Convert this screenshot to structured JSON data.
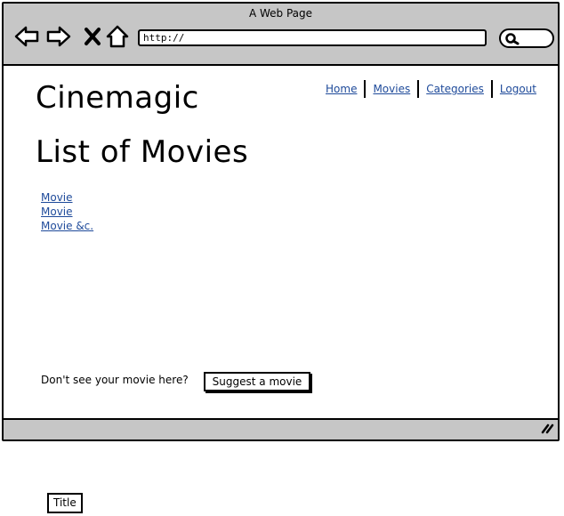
{
  "window": {
    "title": "A Web Page"
  },
  "browser": {
    "url": "http://"
  },
  "nav": {
    "links": [
      "Home",
      "Movies",
      "Categories",
      "Logout"
    ]
  },
  "header": {
    "brand": "Cinemagic"
  },
  "main": {
    "title": "List of Movies",
    "movies": [
      "Movie",
      "Movie",
      "Movie &c."
    ],
    "suggest_prompt": "Don't see your movie here?",
    "suggest_button": "Suggest a movie"
  },
  "annotation": {
    "label": "Title"
  },
  "icons": {
    "back": "back-arrow-icon",
    "forward": "forward-arrow-icon",
    "stop": "close-icon",
    "home": "home-icon",
    "search": "search-icon",
    "resize": "resize-grip-icon"
  },
  "colors": {
    "chrome": "#c6c6c6",
    "link": "#1e4a9a"
  }
}
